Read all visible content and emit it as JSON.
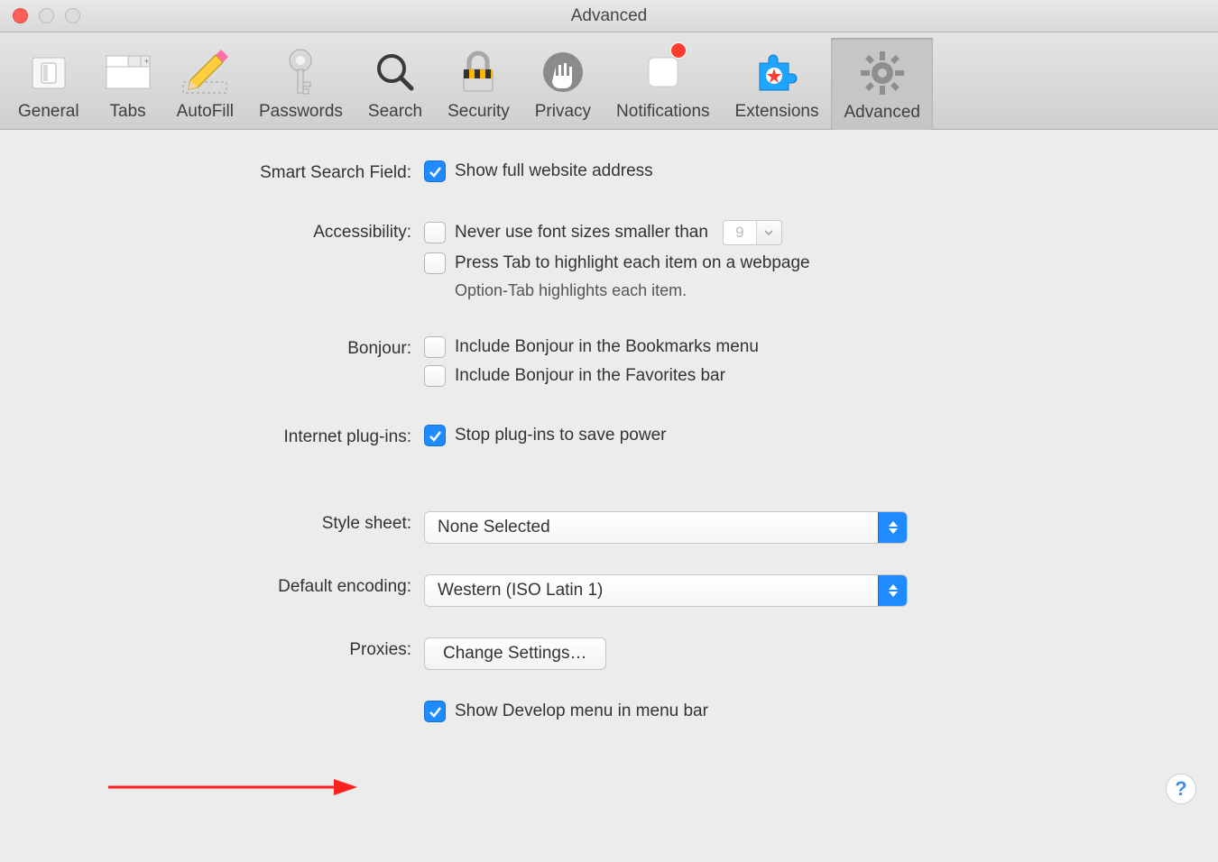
{
  "window": {
    "title": "Advanced"
  },
  "toolbar": {
    "items": [
      {
        "label": "General"
      },
      {
        "label": "Tabs"
      },
      {
        "label": "AutoFill"
      },
      {
        "label": "Passwords"
      },
      {
        "label": "Search"
      },
      {
        "label": "Security"
      },
      {
        "label": "Privacy"
      },
      {
        "label": "Notifications"
      },
      {
        "label": "Extensions"
      },
      {
        "label": "Advanced"
      }
    ]
  },
  "sections": {
    "smartSearch": {
      "label": "Smart Search Field:",
      "showFullAddress": {
        "checked": true,
        "text": "Show full website address"
      }
    },
    "accessibility": {
      "label": "Accessibility:",
      "minFont": {
        "checked": false,
        "text": "Never use font sizes smaller than",
        "value": "9"
      },
      "pressTab": {
        "checked": false,
        "text": "Press Tab to highlight each item on a webpage"
      },
      "hint": "Option-Tab highlights each item."
    },
    "bonjour": {
      "label": "Bonjour:",
      "bookmarks": {
        "checked": false,
        "text": "Include Bonjour in the Bookmarks menu"
      },
      "favorites": {
        "checked": false,
        "text": "Include Bonjour in the Favorites bar"
      }
    },
    "plugins": {
      "label": "Internet plug-ins:",
      "stop": {
        "checked": true,
        "text": "Stop plug-ins to save power"
      }
    },
    "stylesheet": {
      "label": "Style sheet:",
      "value": "None Selected"
    },
    "encoding": {
      "label": "Default encoding:",
      "value": "Western (ISO Latin 1)"
    },
    "proxies": {
      "label": "Proxies:",
      "button": "Change Settings…"
    },
    "develop": {
      "checked": true,
      "text": "Show Develop menu in menu bar"
    }
  },
  "help": "?"
}
